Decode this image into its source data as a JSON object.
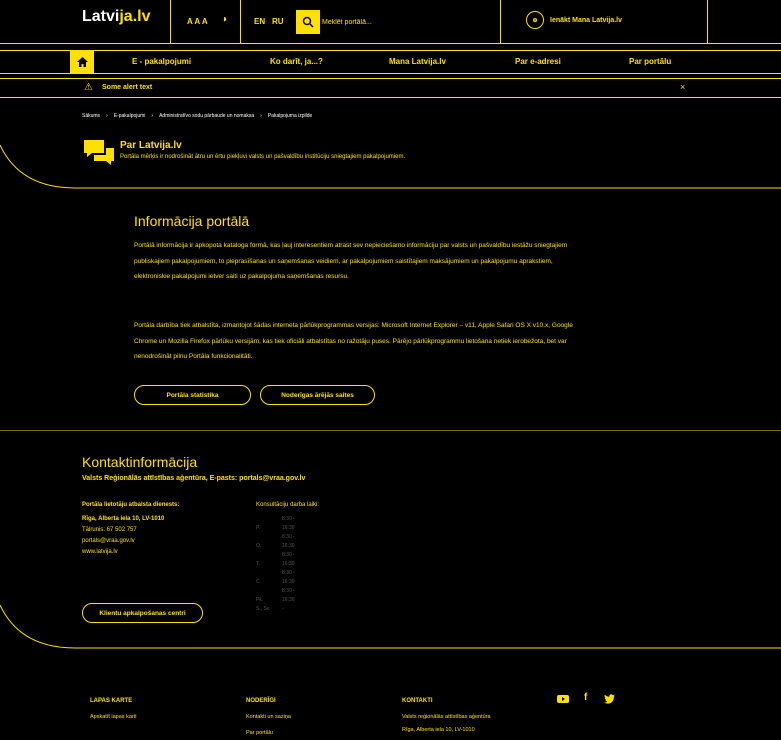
{
  "header": {
    "logo_a": "Latvi",
    "logo_b": "ja.lv",
    "font_size": "A A A",
    "contrast_icon": "contrast-icon",
    "lang_en": "EN",
    "lang_ru": "RU",
    "search_placeholder": "Meklēt portālā...",
    "login_label": "Ienākt Mana Latvija.lv"
  },
  "nav": {
    "items": [
      "E - pakalpojumi",
      "Ko darīt, ja...?",
      "Mana Latvija.lv",
      "Par e-adresi",
      "Par portālu"
    ]
  },
  "alert": {
    "text": "Some alert text",
    "close": "×"
  },
  "breadcrumb": [
    "Sākums",
    "E-pakalpojumi",
    "Administratīvo sodu pārbaude un nomaksa",
    "Pakalpojuma izpilde"
  ],
  "page": {
    "title": "Par Latvija.lv",
    "desc": "Portāla mērķis ir nodrošināt ātru un ērtu piekļuvi valsts un pašvaldību institūciju sniegtajiem pakalpojumiem."
  },
  "info": {
    "title": "Informācija portālā",
    "p1": "Portālā informācija ir apkopota kataloga formā, kas ļauj interesentiem atrast sev nepieciešamo informāciju par valsts un pašvaldību iestāžu sniegtajiem publiskajiem pakalpojumiem, to pieprasīšanas un saņemšanas veidiem, ar pakalpojumiem saistītajiem maksājumiem un pakalpojumu aprakstiem, elektroniskie pakalpojumi ietver saiti uz pakalpojuma saņemšanas resursu.",
    "p2": "Portāla darbība tiek atbalstīta, izmantojot šādas interneta pārlūkprogrammas versijas: Microsoft Internet Explorer – v11, Apple Safari OS X v10.x, Google Chrome un Mozilla Firefox pārlūku versijām, kas tiek oficiāli atbalstītas no ražotāju puses. Pārējo pārlūkprogrammu lietošana netiek ierobežota, bet var nenodrošināt pilnu Portāla funkcionalitāti.",
    "btn_stats": "Portāla statistika",
    "btn_links": "Noderīgas ārējās saites"
  },
  "contact": {
    "title": "Kontaktinformācija",
    "subtitle": "Valsts Reģionālās attīstības aģentūra, E-pasts: portals@vraa.gov.lv",
    "support_h": "Portāla lietotāju atbalsta dienests:",
    "support_lines": [
      "Rīga, Alberta iela 10, LV-1010",
      "Tālrunis: 67 502 757",
      "portals@vraa.gov.lv",
      "www.latvija.lv"
    ],
    "hours_h": "Konsultāciju darba laiki:",
    "hours": [
      {
        "d": "P.",
        "t": "8:30 - 16:30"
      },
      {
        "d": "O.",
        "t": "8:30 - 16:30"
      },
      {
        "d": "T.",
        "t": "8:30 - 16:30"
      },
      {
        "d": "C.",
        "t": "8:30 - 16:30"
      },
      {
        "d": "Pk.",
        "t": "8:30 - 16:30"
      },
      {
        "d": "S., Sv.",
        "t": "-"
      }
    ],
    "btn_centers": "Klientu apkalpošanas centri"
  },
  "footer": {
    "col1_h": "LAPAS KARTE",
    "col1_l1": "Apskatīt lapas karti",
    "col2_h": "NODERĪGI",
    "col2_l1": "Kontakti un saziņa",
    "col2_l2": "Par portālu",
    "col3_h": "KONTAKTI",
    "col3_l1": "Valsts reģionālās attīstības aģentūra",
    "col3_l2": "Rīga, Alberta iela 10, LV-1010",
    "social": [
      "youtube-icon",
      "facebook-icon",
      "twitter-icon"
    ]
  },
  "colors": {
    "accent": "#ffe000",
    "background": "#000000"
  }
}
